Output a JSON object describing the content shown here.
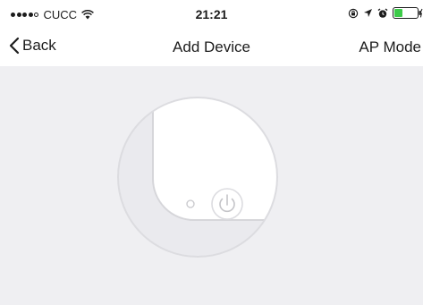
{
  "status_bar": {
    "carrier": "CUCC",
    "time": "21:21",
    "icons": [
      "signal-dots-icon",
      "wifi-icon",
      "screen-lock-icon",
      "location-arrow-icon",
      "alarm-icon",
      "battery-icon"
    ]
  },
  "nav": {
    "back_label": "Back",
    "title": "Add Device",
    "right_label": "AP Mode"
  },
  "illustration": {
    "description_icons": [
      "device-corner-illustration",
      "indicator-led-icon",
      "power-icon"
    ]
  },
  "colors": {
    "background": "#efeff2",
    "nav_bg": "#ffffff",
    "text": "#1c1c1c",
    "battery_fill": "#3dcb49",
    "illustration_line": "#d4d4d8"
  }
}
